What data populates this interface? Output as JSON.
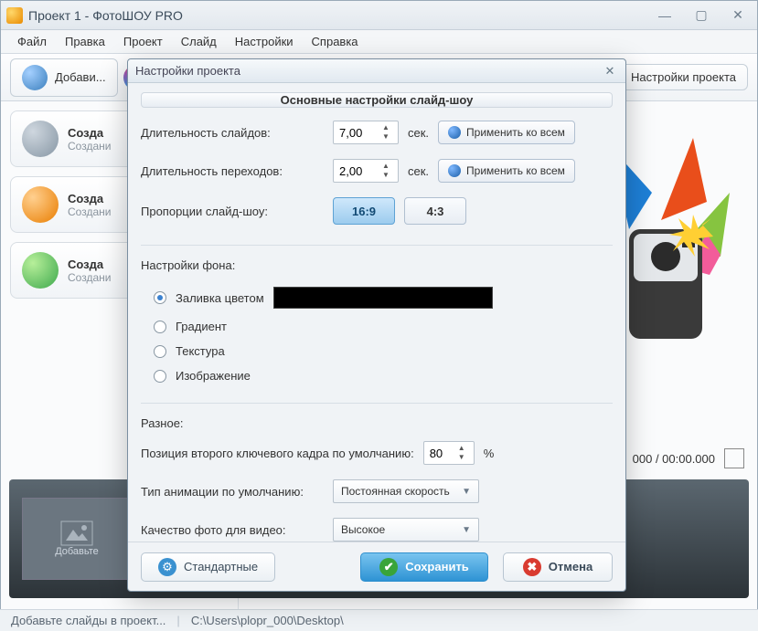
{
  "window": {
    "title": "Проект 1 - ФотоШОУ PRO"
  },
  "menu": {
    "file": "Файл",
    "edit": "Правка",
    "project": "Проект",
    "slide": "Слайд",
    "settings": "Настройки",
    "help": "Справка"
  },
  "toolbar": {
    "add": "Добави...",
    "proj_settings": "Настройки проекта"
  },
  "side": {
    "card1": {
      "title": "Созда",
      "sub": "Создани"
    },
    "card2": {
      "title": "Созда",
      "sub": "Создани"
    },
    "card3": {
      "title": "Созда",
      "sub": "Создани"
    }
  },
  "preview": {
    "timecode": "000 / 00:00.000"
  },
  "drop": {
    "label": "Добавьте"
  },
  "status": {
    "hint": "Добавьте слайды в проект...",
    "path": "C:\\Users\\plopr_000\\Desktop\\"
  },
  "dialog": {
    "title": "Настройки проекта",
    "header": "Основные настройки слайд-шоу",
    "slide_len_label": "Длительность слайдов:",
    "slide_len_value": "7,00",
    "trans_len_label": "Длительность переходов:",
    "trans_len_value": "2,00",
    "sec_unit": "сек.",
    "apply_all": "Применить ко всем",
    "aspect_label": "Пропорции слайд-шоу:",
    "aspect_169": "16:9",
    "aspect_43": "4:3",
    "bg_section": "Настройки фона:",
    "bg_fill": "Заливка цветом",
    "bg_gradient": "Градиент",
    "bg_texture": "Текстура",
    "bg_image": "Изображение",
    "misc_section": "Разное:",
    "key2_label": "Позиция второго ключевого кадра по умолчанию:",
    "key2_value": "80",
    "percent": "%",
    "anim_label": "Тип анимации по умолчанию:",
    "anim_value": "Постоянная скорость",
    "quality_label": "Качество фото для видео:",
    "quality_value": "Высокое",
    "defaults_btn": "Стандартные",
    "save_btn": "Сохранить",
    "cancel_btn": "Отмена"
  }
}
